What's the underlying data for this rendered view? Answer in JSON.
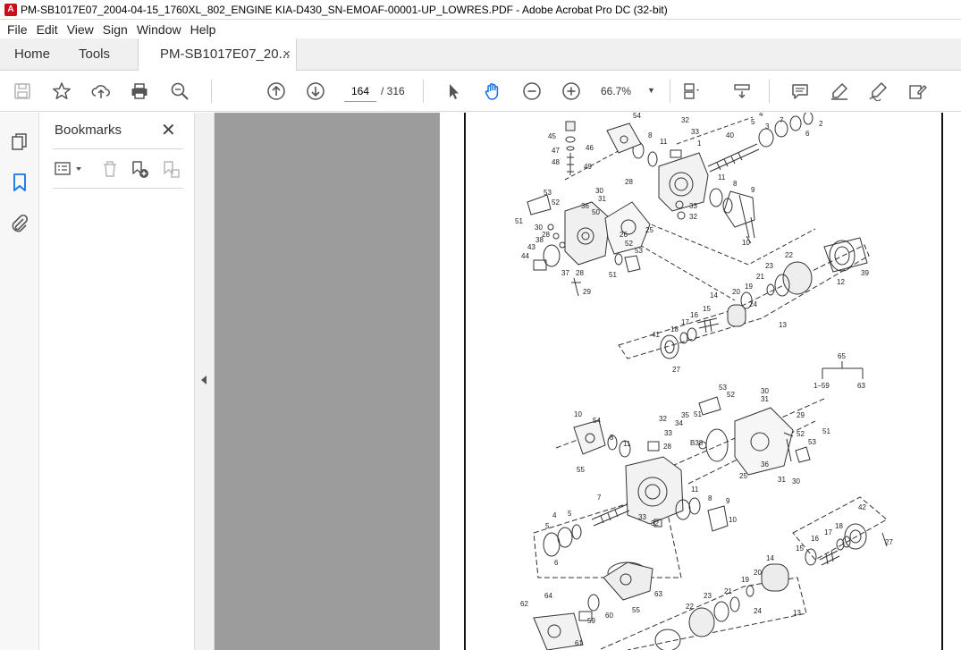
{
  "window": {
    "title": "PM-SB1017E07_2004-04-15_1760XL_802_ENGINE KIA-D430_SN-EMOAF-00001-UP_LOWRES.PDF - Adobe Acrobat Pro DC (32-bit)"
  },
  "menu": [
    "File",
    "Edit",
    "View",
    "Sign",
    "Window",
    "Help"
  ],
  "tabs": {
    "home": "Home",
    "tools": "Tools",
    "document": "PM-SB1017E07_20...",
    "close": "×"
  },
  "toolbar": {
    "page_current": "164",
    "page_total": "/ 316",
    "zoom": "66.7%",
    "zoom_chevron": "▼",
    "icons": [
      "save-icon",
      "bookmark-star-icon",
      "upload-icon",
      "print-icon",
      "search-zoom-icon",
      "prev-page-icon",
      "next-page-icon",
      "select-arrow-icon",
      "hand-icon",
      "zoom-out-icon",
      "zoom-in-icon",
      "page-display-icon",
      "scroll-mode-icon",
      "comment-icon",
      "highlight-icon",
      "sign-icon",
      "edit-icon"
    ]
  },
  "sidebar": {
    "title": "Bookmarks",
    "close": "✕",
    "tools": [
      "options-list-icon",
      "delete-bookmark-icon",
      "new-bookmark-icon",
      "bookmark-from-structure-icon"
    ],
    "rail": [
      "pages-icon",
      "bookmarks-icon",
      "attachments-icon"
    ]
  },
  "diagram": {
    "top_labels": [
      "54",
      "32",
      "8",
      "11",
      "33",
      "4",
      "5",
      "3",
      "7",
      "6",
      "2",
      "45",
      "46",
      "47",
      "48",
      "49",
      "40",
      "1",
      "28",
      "11",
      "8",
      "9",
      "53",
      "52",
      "30",
      "31",
      "50",
      "51",
      "30",
      "28",
      "38",
      "43",
      "44",
      "36",
      "26",
      "25",
      "53",
      "52",
      "37",
      "28",
      "51",
      "29",
      "33",
      "32",
      "10",
      "22",
      "23",
      "21",
      "19",
      "20",
      "24",
      "12",
      "39",
      "14",
      "15",
      "16",
      "17",
      "18",
      "13",
      "41",
      "27"
    ],
    "tree_root": "65",
    "tree_left": "1–59",
    "tree_right": "63",
    "bottom_labels": [
      "53",
      "52",
      "30",
      "31",
      "10",
      "54",
      "32",
      "35",
      "51",
      "34",
      "33",
      "29",
      "52",
      "53",
      "51",
      "28",
      "B38",
      "8",
      "11",
      "55",
      "25",
      "36",
      "31",
      "30",
      "7",
      "11",
      "8",
      "9",
      "4",
      "5",
      "33",
      "32",
      "10",
      "5",
      "6",
      "42",
      "18",
      "17",
      "16",
      "15",
      "27",
      "14",
      "20",
      "19",
      "63",
      "21",
      "23",
      "24",
      "22",
      "13",
      "62",
      "64",
      "59",
      "60",
      "55",
      "61"
    ]
  },
  "colors": {
    "accent_blue": "#1473e6",
    "tab_bg": "#f0f0f0",
    "viewer_gray": "#9c9c9c"
  }
}
